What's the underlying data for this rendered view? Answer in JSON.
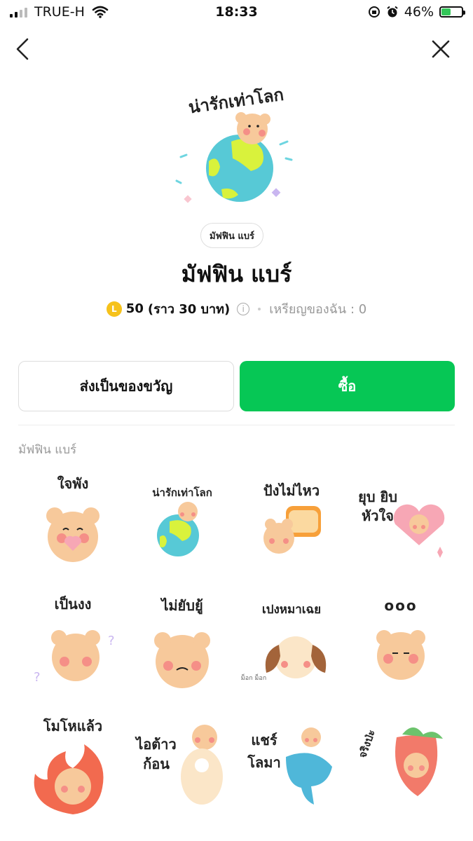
{
  "status_bar": {
    "carrier": "TRUE-H",
    "time": "18:33",
    "battery": "46%",
    "battery_level": 0.46
  },
  "nav": {
    "back_icon": "chevron-left-icon",
    "close_icon": "close-icon"
  },
  "product": {
    "hero_caption": "น่ารักเท่าโลก",
    "author": "มัฟฟิน แบร์",
    "title": "มัฟฟิน แบร์",
    "coin_letter": "L",
    "price": "50",
    "price_baht": "(ราว 30 บาท)",
    "my_coins": "เหรียญของฉัน : 0"
  },
  "actions": {
    "gift_label": "ส่งเป็นของขวัญ",
    "buy_label": "ซื้อ",
    "buy_color": "#06c755"
  },
  "section_label": "มัฟฟิน แบร์",
  "stickers": [
    {
      "caption": "ใจพัง"
    },
    {
      "caption": "น่ารักเท่าโลก"
    },
    {
      "caption": "ปังไม่ไหว"
    },
    {
      "caption": "ยุบ ยิบ หัวใจ"
    },
    {
      "caption": "เป็นงง"
    },
    {
      "caption": "ไม่ยับยู้"
    },
    {
      "caption": "เปงหมาเฉย",
      "sub": "ม็อก ม็อก"
    },
    {
      "caption": "ooo"
    },
    {
      "caption": "โมโหแล้ว"
    },
    {
      "caption": "ไอต้าว ก้อน"
    },
    {
      "caption": "แชร์ โลมา"
    },
    {
      "caption": "จริงป่ะ"
    }
  ],
  "colors": {
    "bear": "#f7c99b",
    "cheek": "#f58f87",
    "earth_sea": "#57c9d6",
    "earth_land": "#d9f23c",
    "heart": "#f7a7b5",
    "fire": "#f26a4f",
    "dolphin": "#4fb7d9",
    "strawberry": "#f27a6a"
  }
}
